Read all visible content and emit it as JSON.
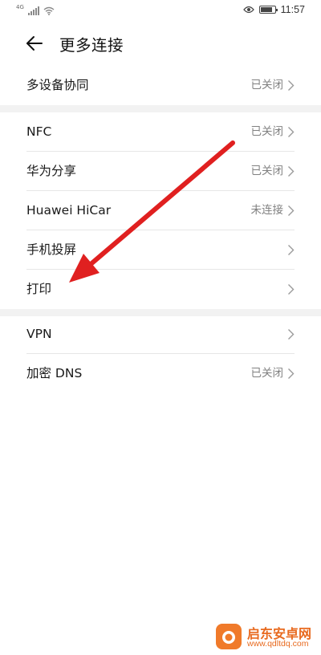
{
  "status_bar": {
    "network_label": "4G",
    "time": "11:57",
    "battery_level": 0.85
  },
  "header": {
    "title": "更多连接",
    "back_icon": "arrow-left-icon"
  },
  "groups": [
    {
      "items": [
        {
          "label": "多设备协同",
          "status": "已关闭"
        }
      ]
    },
    {
      "items": [
        {
          "label": "NFC",
          "status": "已关闭"
        },
        {
          "label": "华为分享",
          "status": "已关闭"
        },
        {
          "label": "Huawei HiCar",
          "status": "未连接"
        },
        {
          "label": "手机投屏",
          "status": ""
        },
        {
          "label": "打印",
          "status": ""
        }
      ]
    },
    {
      "items": [
        {
          "label": "VPN",
          "status": ""
        },
        {
          "label": "加密 DNS",
          "status": "已关闭"
        }
      ]
    }
  ],
  "annotation": {
    "color": "#e02020"
  },
  "watermark": {
    "name": "启东安卓网",
    "url": "www.qdltdq.com"
  }
}
